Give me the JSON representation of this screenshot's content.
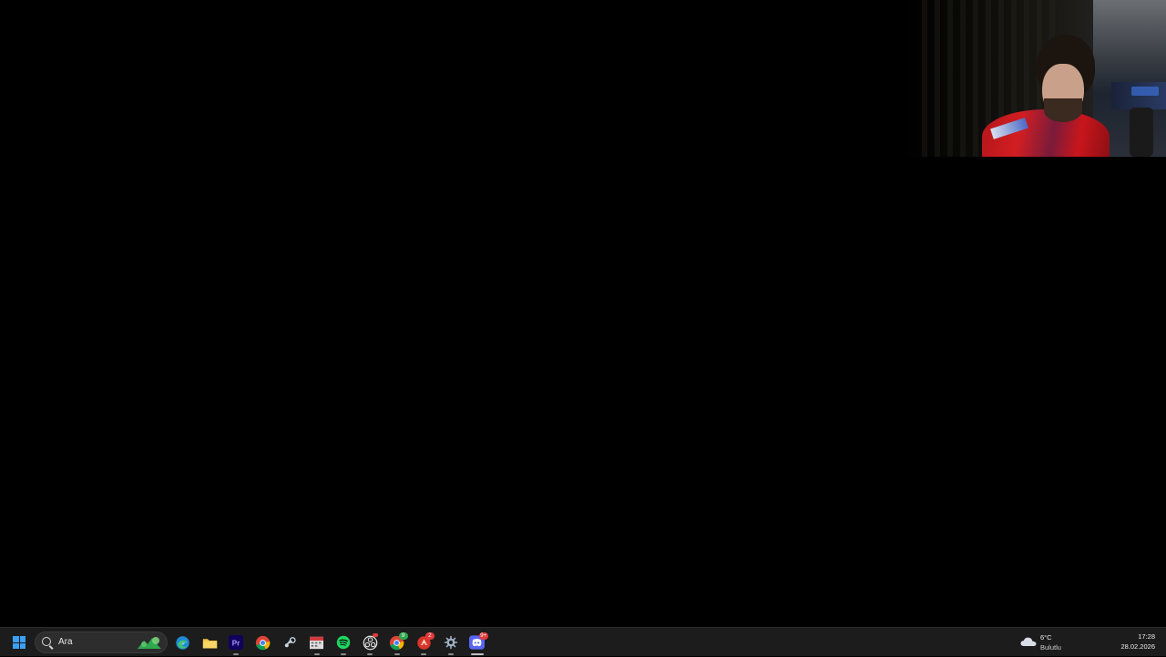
{
  "taskbar": {
    "search_placeholder": "Ara",
    "apps": [
      {
        "name": "edge-icon"
      },
      {
        "name": "file-explorer-icon"
      },
      {
        "name": "premiere-pro-icon",
        "text": "Pr"
      },
      {
        "name": "chrome-icon"
      },
      {
        "name": "steam-icon"
      },
      {
        "name": "calendar-app-icon"
      },
      {
        "name": "spotify-icon"
      },
      {
        "name": "obs-icon"
      },
      {
        "name": "chrome-profile-icon",
        "badge": "9"
      },
      {
        "name": "red-app-icon",
        "badge": "2"
      },
      {
        "name": "settings-gear-icon"
      },
      {
        "name": "discord-icon",
        "badge": "9+"
      }
    ],
    "weather": {
      "temperature": "6°C",
      "condition": "Bulutlu",
      "icon": "cloud-icon"
    },
    "clock": {
      "time": "17:28",
      "date": "28.02.2026"
    }
  },
  "colors": {
    "taskbar_bg": "#1c1c1c",
    "windows_blue": "#3aa0f3",
    "badge_red": "#e03a3a",
    "badge_green": "#2fa84f",
    "desktop_bg": "#000000"
  }
}
